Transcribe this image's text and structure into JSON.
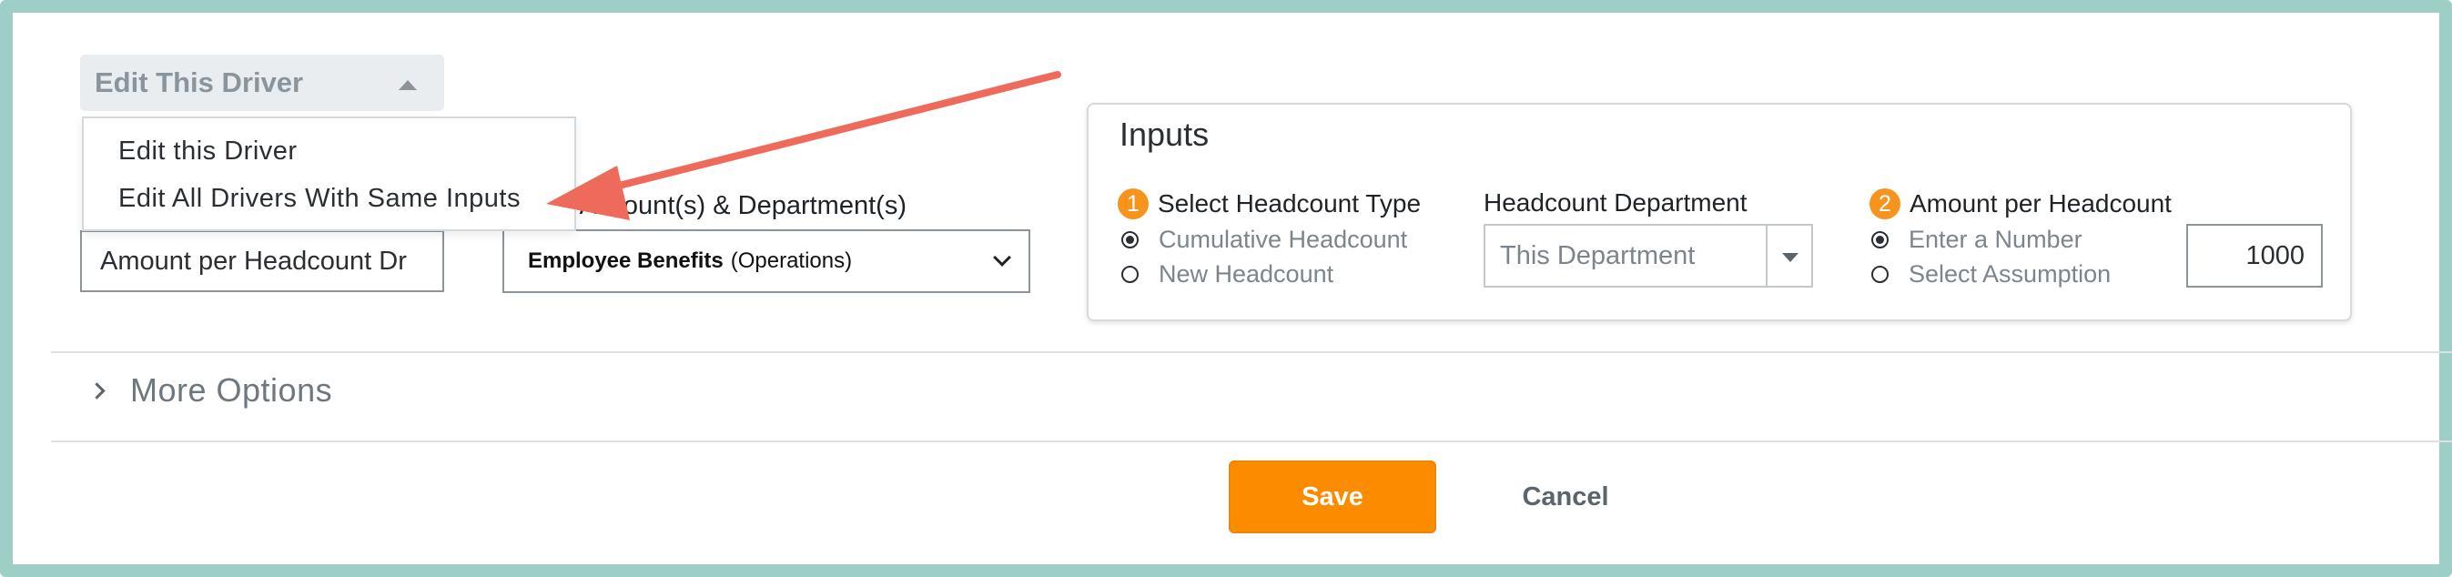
{
  "edit_toggle": {
    "label": "Edit This Driver"
  },
  "edit_menu": {
    "items": [
      "Edit this Driver",
      "Edit All Drivers With Same Inputs"
    ]
  },
  "driver_name": {
    "value": "Amount per Headcount Dr"
  },
  "maps_to": {
    "label": "Maps to Account(s) & Department(s)",
    "label_visible": "o Account(s) & Department(s)",
    "account": "Employee Benefits",
    "department": "(Operations)"
  },
  "inputs": {
    "title": "Inputs",
    "headcount_type": {
      "step": "1",
      "label": "Select Headcount Type",
      "options": [
        "Cumulative Headcount",
        "New Headcount"
      ],
      "selected": "Cumulative Headcount"
    },
    "headcount_department": {
      "label": "Headcount Department",
      "value": "This Department"
    },
    "amount": {
      "step": "2",
      "label": "Amount per Headcount",
      "options": [
        "Enter a Number",
        "Select Assumption"
      ],
      "selected": "Enter a Number",
      "value": "1000"
    }
  },
  "more_options": {
    "label": "More Options"
  },
  "actions": {
    "save": "Save",
    "cancel": "Cancel"
  },
  "colors": {
    "accent": "#fb8c00",
    "frame": "#9ecfc7",
    "annotation_arrow": "#ee6b5b"
  }
}
